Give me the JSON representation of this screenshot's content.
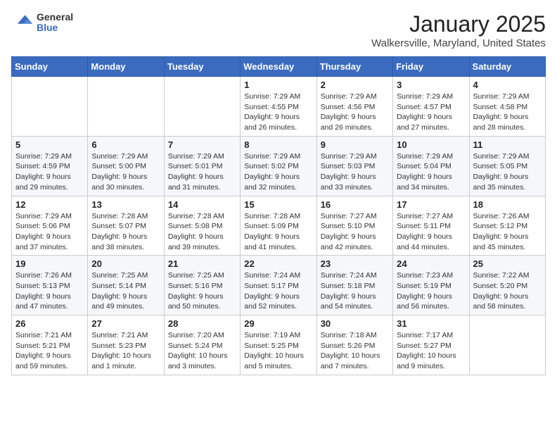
{
  "header": {
    "logo_general": "General",
    "logo_blue": "Blue",
    "month_title": "January 2025",
    "location": "Walkersville, Maryland, United States"
  },
  "days_of_week": [
    "Sunday",
    "Monday",
    "Tuesday",
    "Wednesday",
    "Thursday",
    "Friday",
    "Saturday"
  ],
  "weeks": [
    [
      {
        "day": "",
        "info": ""
      },
      {
        "day": "",
        "info": ""
      },
      {
        "day": "",
        "info": ""
      },
      {
        "day": "1",
        "info": "Sunrise: 7:29 AM\nSunset: 4:55 PM\nDaylight: 9 hours and 26 minutes."
      },
      {
        "day": "2",
        "info": "Sunrise: 7:29 AM\nSunset: 4:56 PM\nDaylight: 9 hours and 26 minutes."
      },
      {
        "day": "3",
        "info": "Sunrise: 7:29 AM\nSunset: 4:57 PM\nDaylight: 9 hours and 27 minutes."
      },
      {
        "day": "4",
        "info": "Sunrise: 7:29 AM\nSunset: 4:58 PM\nDaylight: 9 hours and 28 minutes."
      }
    ],
    [
      {
        "day": "5",
        "info": "Sunrise: 7:29 AM\nSunset: 4:59 PM\nDaylight: 9 hours and 29 minutes."
      },
      {
        "day": "6",
        "info": "Sunrise: 7:29 AM\nSunset: 5:00 PM\nDaylight: 9 hours and 30 minutes."
      },
      {
        "day": "7",
        "info": "Sunrise: 7:29 AM\nSunset: 5:01 PM\nDaylight: 9 hours and 31 minutes."
      },
      {
        "day": "8",
        "info": "Sunrise: 7:29 AM\nSunset: 5:02 PM\nDaylight: 9 hours and 32 minutes."
      },
      {
        "day": "9",
        "info": "Sunrise: 7:29 AM\nSunset: 5:03 PM\nDaylight: 9 hours and 33 minutes."
      },
      {
        "day": "10",
        "info": "Sunrise: 7:29 AM\nSunset: 5:04 PM\nDaylight: 9 hours and 34 minutes."
      },
      {
        "day": "11",
        "info": "Sunrise: 7:29 AM\nSunset: 5:05 PM\nDaylight: 9 hours and 35 minutes."
      }
    ],
    [
      {
        "day": "12",
        "info": "Sunrise: 7:29 AM\nSunset: 5:06 PM\nDaylight: 9 hours and 37 minutes."
      },
      {
        "day": "13",
        "info": "Sunrise: 7:28 AM\nSunset: 5:07 PM\nDaylight: 9 hours and 38 minutes."
      },
      {
        "day": "14",
        "info": "Sunrise: 7:28 AM\nSunset: 5:08 PM\nDaylight: 9 hours and 39 minutes."
      },
      {
        "day": "15",
        "info": "Sunrise: 7:28 AM\nSunset: 5:09 PM\nDaylight: 9 hours and 41 minutes."
      },
      {
        "day": "16",
        "info": "Sunrise: 7:27 AM\nSunset: 5:10 PM\nDaylight: 9 hours and 42 minutes."
      },
      {
        "day": "17",
        "info": "Sunrise: 7:27 AM\nSunset: 5:11 PM\nDaylight: 9 hours and 44 minutes."
      },
      {
        "day": "18",
        "info": "Sunrise: 7:26 AM\nSunset: 5:12 PM\nDaylight: 9 hours and 45 minutes."
      }
    ],
    [
      {
        "day": "19",
        "info": "Sunrise: 7:26 AM\nSunset: 5:13 PM\nDaylight: 9 hours and 47 minutes."
      },
      {
        "day": "20",
        "info": "Sunrise: 7:25 AM\nSunset: 5:14 PM\nDaylight: 9 hours and 49 minutes."
      },
      {
        "day": "21",
        "info": "Sunrise: 7:25 AM\nSunset: 5:16 PM\nDaylight: 9 hours and 50 minutes."
      },
      {
        "day": "22",
        "info": "Sunrise: 7:24 AM\nSunset: 5:17 PM\nDaylight: 9 hours and 52 minutes."
      },
      {
        "day": "23",
        "info": "Sunrise: 7:24 AM\nSunset: 5:18 PM\nDaylight: 9 hours and 54 minutes."
      },
      {
        "day": "24",
        "info": "Sunrise: 7:23 AM\nSunset: 5:19 PM\nDaylight: 9 hours and 56 minutes."
      },
      {
        "day": "25",
        "info": "Sunrise: 7:22 AM\nSunset: 5:20 PM\nDaylight: 9 hours and 58 minutes."
      }
    ],
    [
      {
        "day": "26",
        "info": "Sunrise: 7:21 AM\nSunset: 5:21 PM\nDaylight: 9 hours and 59 minutes."
      },
      {
        "day": "27",
        "info": "Sunrise: 7:21 AM\nSunset: 5:23 PM\nDaylight: 10 hours and 1 minute."
      },
      {
        "day": "28",
        "info": "Sunrise: 7:20 AM\nSunset: 5:24 PM\nDaylight: 10 hours and 3 minutes."
      },
      {
        "day": "29",
        "info": "Sunrise: 7:19 AM\nSunset: 5:25 PM\nDaylight: 10 hours and 5 minutes."
      },
      {
        "day": "30",
        "info": "Sunrise: 7:18 AM\nSunset: 5:26 PM\nDaylight: 10 hours and 7 minutes."
      },
      {
        "day": "31",
        "info": "Sunrise: 7:17 AM\nSunset: 5:27 PM\nDaylight: 10 hours and 9 minutes."
      },
      {
        "day": "",
        "info": ""
      }
    ]
  ]
}
